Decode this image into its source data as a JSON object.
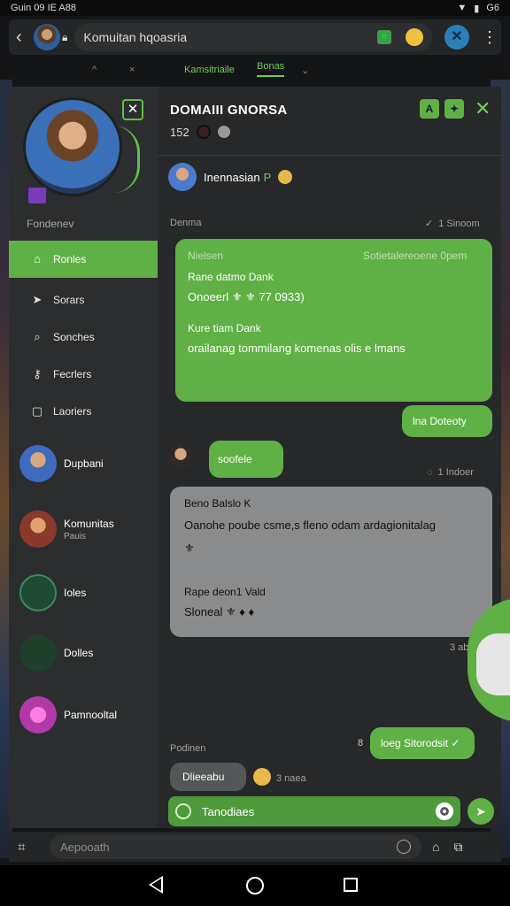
{
  "status_bar": {
    "time": "Guin 09 IE A88",
    "carrier": "G6"
  },
  "topbar": {
    "url_text": "Komuitan hqoasria"
  },
  "tabs": [
    "^",
    "×",
    "Kamsitriaile",
    "Bonas",
    "⌄"
  ],
  "sidebar": {
    "section_label": "Fondenev",
    "items": [
      {
        "label": "Ronles",
        "icon": "home-icon",
        "active": true
      },
      {
        "label": "Sorars",
        "icon": "send-icon",
        "active": false
      },
      {
        "label": "Sonches",
        "icon": "search-icon",
        "active": false
      },
      {
        "label": "Fecrlers",
        "icon": "key-icon",
        "active": false
      },
      {
        "label": "Laoriers",
        "icon": "bookmark-icon",
        "active": false
      }
    ],
    "users": [
      {
        "name": "Dupbani",
        "sub": ""
      },
      {
        "name": "Komunitas",
        "sub": "Pauis"
      },
      {
        "name": "Ioles",
        "sub": ""
      },
      {
        "name": "Dolles",
        "sub": ""
      },
      {
        "name": "Pamnooltal",
        "sub": ""
      }
    ]
  },
  "chat": {
    "title": "DOMAIII GNORSA",
    "member_count": "152",
    "lang_user": "Inennasian",
    "lang_suffix": "P",
    "section_label": "Denma",
    "section_meta": "1 Sinoom",
    "msg1": {
      "header": "Nielsen",
      "header_right": "Sotietalereoene 0pem",
      "l1a": "Rane datmo Dank",
      "l1b": "Onoeerl ⚜ ⚜ 77 0933)",
      "l2a": "Kure tiam Dank",
      "l2b": "orailanag tommilang komenas olis e lmans"
    },
    "reply_chip": "lna Doteoty",
    "msg2_text": "soofele",
    "msg2_meta": "1 Indoer",
    "msg3": {
      "header": "Beno Balslo K",
      "l1": "Oanohe poube csme,s fleno odam ardagionitalag",
      "l1b": "⚜",
      "l2a": "Rape deon1 Vald",
      "l2b": "Sloneal ⚜ ♦ ♦"
    },
    "msg3_meta": "3 ab",
    "out2_prefix": "8",
    "out2_text": "loeg Sitorodsit ✓",
    "bottom_label": "Podinen",
    "last_chip": "Dlieeabu",
    "last_meta": "3 naea"
  },
  "composer": {
    "text": "Tanodiaes"
  },
  "bottom_bar": {
    "placeholder": "Aepooath"
  },
  "colors": {
    "accent": "#5fb045",
    "panel": "#2b2d2e",
    "chat_bg": "#262829"
  }
}
